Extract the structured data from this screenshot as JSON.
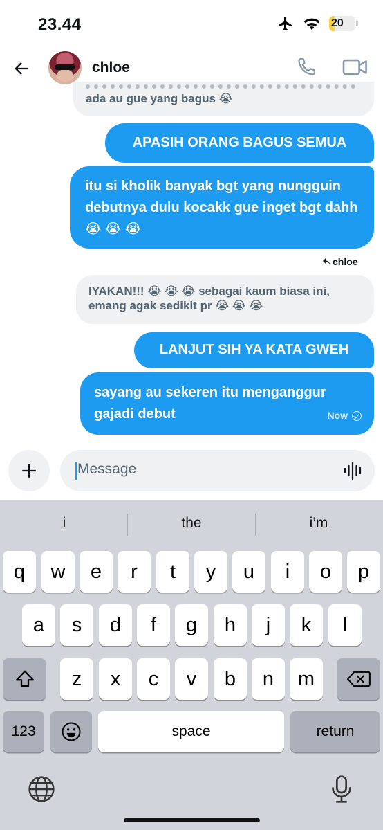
{
  "status_bar": {
    "time": "23.44",
    "battery": "20",
    "battery_level": 0.2
  },
  "header": {
    "contact_name": "chloe",
    "icons": [
      "back-arrow-icon",
      "phone-icon",
      "video-icon"
    ]
  },
  "messages": [
    {
      "direction": "in",
      "text": "ada au gue yang bagus 😭"
    },
    {
      "direction": "out",
      "text": "APASIH ORANG BAGUS SEMUA"
    },
    {
      "direction": "out",
      "text": "itu si kholik banyak bgt yang nungguin debutnya dulu kocakk gue inget bgt dahh😭 😭 😭"
    },
    {
      "direction": "in",
      "reply_label": "chloe",
      "text": "IYAKAN!!! 😭 😭 😭  sebagai kaum biasa ini, emang agak sedikit pr 😭 😭 😭"
    },
    {
      "direction": "out",
      "text": "LANJUT SIH YA KATA GWEH"
    },
    {
      "direction": "out",
      "text": "sayang au sekeren itu menganggur gajadi debut",
      "status": "Now"
    }
  ],
  "composer": {
    "placeholder": "Message"
  },
  "keyboard": {
    "suggestions": [
      "i",
      "the",
      "i’m"
    ],
    "row1": [
      "q",
      "w",
      "e",
      "r",
      "t",
      "y",
      "u",
      "i",
      "o",
      "p"
    ],
    "row2": [
      "a",
      "s",
      "d",
      "f",
      "g",
      "h",
      "j",
      "k",
      "l"
    ],
    "row3": [
      "z",
      "x",
      "c",
      "v",
      "b",
      "n",
      "m"
    ],
    "numbers_label": "123",
    "space_label": "space",
    "return_label": "return"
  },
  "colors": {
    "accent": "#1d9bf0",
    "incoming_bubble": "#eff1f3",
    "keyboard_bg": "#d1d4da"
  }
}
